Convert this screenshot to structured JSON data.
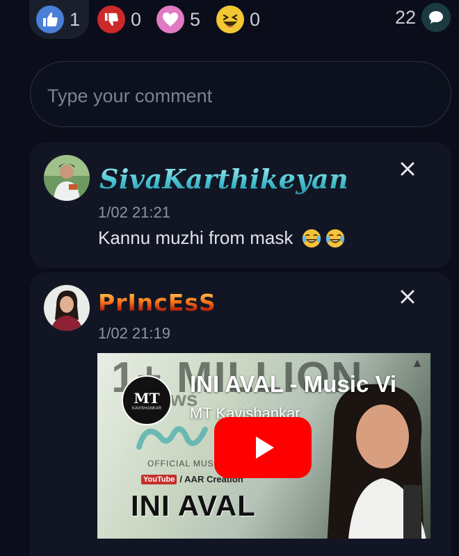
{
  "reactions": {
    "like": {
      "count": "1",
      "icon": "thumbs-up-icon",
      "color": "#4a7fd8"
    },
    "dislike": {
      "count": "0",
      "icon": "thumbs-down-icon",
      "color": "#cc2a2a"
    },
    "love": {
      "count": "5",
      "icon": "heart-icon",
      "color": "#e07bc3"
    },
    "laugh": {
      "count": "0",
      "icon": "laughing-face-icon",
      "color": "#f2c733"
    }
  },
  "comments_count": {
    "count": "22",
    "icon": "speech-bubble-icon"
  },
  "comment_input": {
    "placeholder": "Type your comment",
    "value": ""
  },
  "comments": [
    {
      "username": "SivaKarthikeyan",
      "timestamp": "1/02 21:21",
      "text": "Kannu muzhi from mask",
      "emojis": [
        "laughing-crying-emoji",
        "laughing-crying-emoji"
      ]
    },
    {
      "username": "PrIncEsS",
      "timestamp": "1/02 21:19",
      "video": {
        "title": "INI AVAL - Music Vi",
        "channel": "MT Kavishankar",
        "channel_logo_text": "MT",
        "channel_logo_subtext": "KAVISHANKAR",
        "thumbnail_texts": {
          "headline": "1+ MILLION",
          "subheadline": "Views",
          "official": "OFFICIAL MUSIC V",
          "youtube": "YouTube",
          "creation": "/ AAR  Creation",
          "big_title": "INI AVAL"
        }
      }
    }
  ]
}
